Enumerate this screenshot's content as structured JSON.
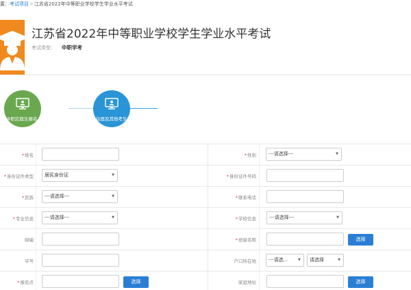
{
  "breadcrumb": {
    "prefix": "置：",
    "link": "考试项目",
    "separator": ">",
    "current": "江苏省2022年中等职业学校学生学业水平考试"
  },
  "header": {
    "title": "江苏省2022年中等职业学校学生学业水平考试",
    "type_label": "考试类型：",
    "type_value": "中职学考"
  },
  "steps": [
    {
      "label": "中职应届生报名"
    },
    {
      "label": "往届及其他考生报"
    }
  ],
  "form": {
    "name_label": "姓名",
    "gender_label": "性别",
    "gender_value": "---请选择---",
    "id_type_label": "身份证件类型",
    "id_type_value": "居民身份证",
    "id_number_label": "身份证件号码",
    "ethnicity_label": "民族",
    "ethnicity_value": "---请选择---",
    "phone_label": "联系电话",
    "major_label": "专业信息",
    "major_value": "---请选择---",
    "school_label": "学校信息",
    "school_value": "---请选择---",
    "postcode_label": "邮编",
    "class_label": "班级名称",
    "class_button": "选择",
    "student_id_label": "学号",
    "hukou_label": "户口所在地",
    "hukou_province": "---请选... ",
    "hukou_city": "请选择",
    "site_label": "报名点",
    "site_button": "选择",
    "address_label": "家庭地址",
    "address_button": "选择"
  },
  "colors": {
    "logo": "#f08a1e",
    "step_done": "#6aa84f",
    "step_active": "#2a95d6",
    "button": "#2a7fd4",
    "required": "#e03c3c"
  }
}
